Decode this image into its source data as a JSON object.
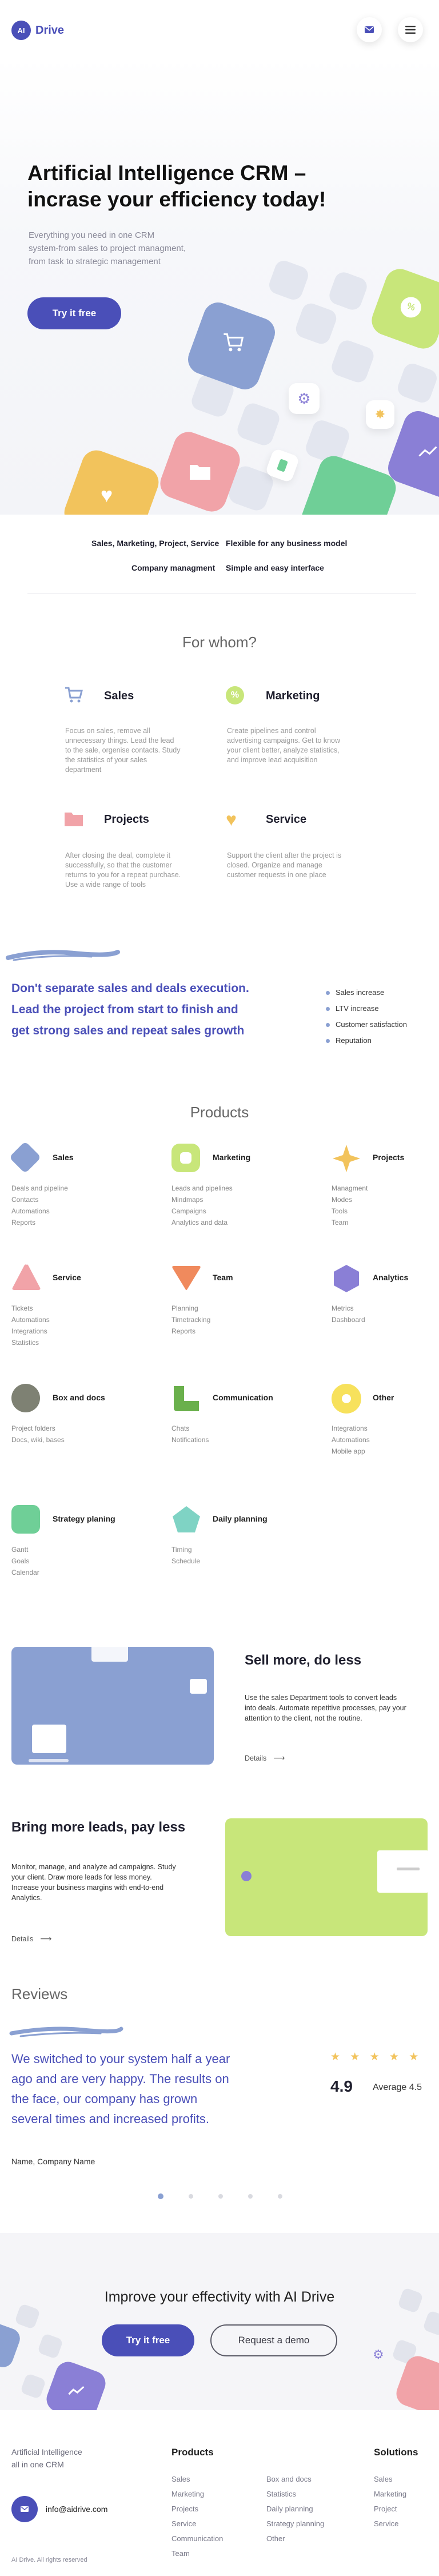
{
  "header": {
    "logo_badge": "AI",
    "logo_text": "Drive",
    "mail_icon": "mail-icon",
    "menu_icon": "menu-icon"
  },
  "hero": {
    "title_line1": "Artificial Intelligence CRM –",
    "title_line2": "incrase your efficiency today!",
    "subtitle_line1": "Everything you need in one CRM",
    "subtitle_line2": "system-from sales to project managment,",
    "subtitle_line3": "from task to strategic management",
    "cta": "Try it free"
  },
  "features": {
    "f1": "Sales, Marketing, Project, Service",
    "f2": "Flexible for any business model",
    "f3": "Company managment",
    "f4": "Simple and easy interface"
  },
  "for_whom": {
    "title": "For whom?",
    "items": [
      {
        "title": "Sales",
        "icon": "cart-icon",
        "l1": "Focus on sales, remove all",
        "l2": "unnecessary things. Lead the lead",
        "l3": "to the sale, orgenise contacts. Study",
        "l4": "the statistics of your sales",
        "l5": "department"
      },
      {
        "title": "Marketing",
        "icon": "percent-icon",
        "l1": "Create pipelines and control",
        "l2": "advertising campaigns. Get to know",
        "l3": "your client better, analyze statistics,",
        "l4": "and improve lead acquisition",
        "l5": ""
      },
      {
        "title": "Projects",
        "icon": "folder-icon",
        "l1": "After closing the deal, complete it",
        "l2": "successfully, so that the customer",
        "l3": "returns to you for a repeat purchase.",
        "l4": "Use a wide range of tools",
        "l5": ""
      },
      {
        "title": "Service",
        "icon": "heart-icon",
        "l1": "Support the client after the project is",
        "l2": "closed. Organize and manage",
        "l3": "customer requests in one place",
        "l4": "",
        "l5": ""
      }
    ]
  },
  "promo": {
    "line1": "Don't separate sales and deals execution.",
    "line2": "Lead the project from start to finish and",
    "line3": "get strong sales and repeat sales growth",
    "bullets": [
      "Sales increase",
      "LTV increase",
      "Customer satisfaction",
      "Reputation"
    ]
  },
  "products": {
    "title": "Products",
    "items": [
      {
        "name": "Sales",
        "items": [
          "Deals and pipeline",
          "Contacts",
          "Automations",
          "Reports"
        ]
      },
      {
        "name": "Marketing",
        "items": [
          "Leads and pipelines",
          "Mindmaps",
          "Campaigns",
          "Analytics and data"
        ]
      },
      {
        "name": "Projects",
        "items": [
          "Managment",
          "Modes",
          "Tools",
          "Team"
        ]
      },
      {
        "name": "Service",
        "items": [
          "Tickets",
          "Automations",
          "Integrations",
          "Statistics"
        ]
      },
      {
        "name": "Team",
        "items": [
          "Planning",
          "Timetracking",
          "Reports",
          ""
        ]
      },
      {
        "name": "Analytics",
        "items": [
          "Metrics",
          "Dashboard",
          "",
          ""
        ]
      },
      {
        "name": "Box and docs",
        "items": [
          "Project folders",
          "Docs, wiki, bases",
          "",
          ""
        ]
      },
      {
        "name": "Communication",
        "items": [
          "Chats",
          "Notifications",
          "",
          ""
        ]
      },
      {
        "name": "Other",
        "items": [
          "Integrations",
          "Automations",
          "Mobile app",
          ""
        ]
      },
      {
        "name": "Strategy planing",
        "items": [
          "Gantt",
          "Goals",
          "Calendar",
          ""
        ]
      },
      {
        "name": "Daily planning",
        "items": [
          "Timing",
          "Schedule",
          "",
          ""
        ]
      }
    ]
  },
  "sell_more": {
    "title": "Sell more, do less",
    "l1": "Use the sales Department tools to convert leads",
    "l2": "into deals. Automate repetitive processes, pay your",
    "l3": "attention to the client, not the routine.",
    "link": "Details"
  },
  "more_leads": {
    "title": "Bring more leads, pay less",
    "l1": "Monitor, manage, and analyze ad campaigns. Study",
    "l2": "your client. Draw more leads for less money.",
    "l3": "Increase your business margins with end-to-end",
    "l4": "Analytics.",
    "link": "Details"
  },
  "reviews": {
    "title": "Reviews",
    "q1": "We switched to your system half a year",
    "q2": "ago and are very happy. The results on",
    "q3": "the face, our company has grown",
    "q4": "several times and increased profits.",
    "author": "Name, Company Name",
    "stars": "★ ★ ★ ★ ★",
    "score": "4.9",
    "average": "Average 4.5"
  },
  "cta_section": {
    "title": "Improve your effectivity with AI Drive",
    "primary": "Try it free",
    "secondary": "Request a demo"
  },
  "footer": {
    "tag1": "Artificial Intelligence",
    "tag2": "all in one CRM",
    "email": "info@aidrive.com",
    "copyright": "AI Drive. All rights reserved",
    "products_title": "Products",
    "col1": [
      "Sales",
      "Marketing",
      "Projects",
      "Service",
      "Communication",
      "Team"
    ],
    "col2": [
      "Box and docs",
      "Statistics",
      "Daily planning",
      "Strategy planning",
      "Other"
    ],
    "solutions_title": "Solutions",
    "col3": [
      "Sales",
      "Marketing",
      "Project",
      "Service"
    ]
  },
  "colors": {
    "accent": "#4a4fb8",
    "blue_tile": "#8aa0d2",
    "lime": "#c8e67a",
    "pink": "#f1a3a8",
    "yellow": "#f2c35c",
    "green": "#6fcf97",
    "purple": "#8a7fd6",
    "grey_tile": "#e1e4ee"
  }
}
